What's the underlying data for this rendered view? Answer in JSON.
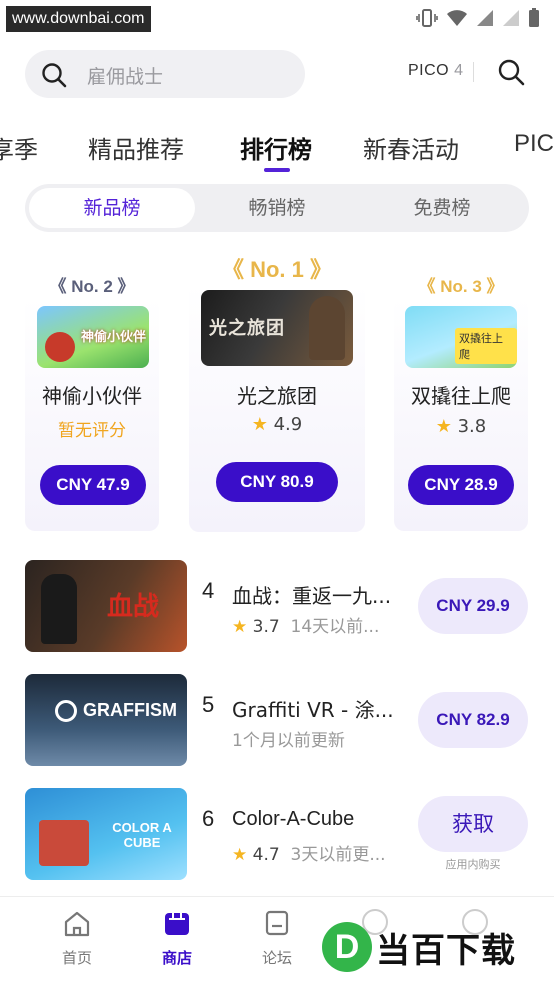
{
  "status_bar": {
    "watermark_url": "www.downbai.com"
  },
  "search": {
    "placeholder": "雇佣战士",
    "pico_label": "PICO",
    "pico_number": "4"
  },
  "main_tabs": [
    {
      "label": "享季"
    },
    {
      "label": "精品推荐"
    },
    {
      "label": "排行榜",
      "active": true
    },
    {
      "label": "新春活动"
    },
    {
      "label": "PIC"
    }
  ],
  "segment": [
    {
      "label": "新品榜",
      "active": true
    },
    {
      "label": "畅销榜"
    },
    {
      "label": "免费榜"
    }
  ],
  "podium": {
    "first": {
      "badge": "No. 1",
      "name": "光之旅团",
      "rating": "4.9",
      "price": "CNY 80.9",
      "thumb_text": "光之旅团"
    },
    "second": {
      "badge": "No. 2",
      "name": "神偷小伙伴",
      "no_rating": "暂无评分",
      "price": "CNY 47.9",
      "thumb_text": "神偷小伙伴"
    },
    "third": {
      "badge": "No. 3",
      "name": "双撬往上爬",
      "rating": "3.8",
      "price": "CNY 28.9",
      "thumb_text": "双撬往上爬"
    }
  },
  "list": [
    {
      "rank": "4",
      "title": "血战：重返一九...",
      "rating": "3.7",
      "meta": "14天以前...",
      "price": "CNY 29.9",
      "thumb_text": "血战"
    },
    {
      "rank": "5",
      "title": "Graffiti VR - 涂...",
      "meta": "1个月以前更新",
      "price": "CNY 82.9",
      "thumb_text": "GRAFFISM"
    },
    {
      "rank": "6",
      "title": "Color-A-Cube",
      "rating": "4.7",
      "meta": "3天以前更...",
      "price": "获取",
      "note": "应用内购买",
      "thumb_text": "COLOR A CUBE"
    }
  ],
  "bottom_nav": [
    {
      "label": "首页",
      "icon": "home-icon"
    },
    {
      "label": "商店",
      "icon": "store-icon",
      "active": true
    },
    {
      "label": "论坛",
      "icon": "forum-icon"
    }
  ],
  "watermark_logo": {
    "letter": "D",
    "text": "当百下载"
  },
  "colors": {
    "accent": "#5423d8",
    "price_button": "#3a0ec9",
    "star": "#f5b521",
    "gold": "#f0a51f"
  }
}
